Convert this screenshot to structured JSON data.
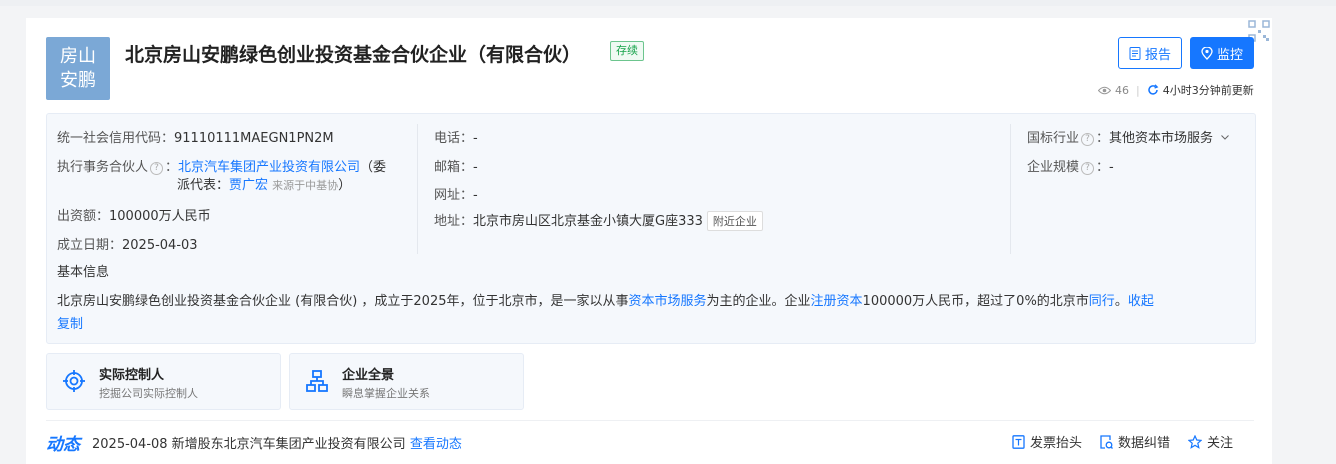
{
  "logo": {
    "line1": "房山",
    "line2": "安鹏"
  },
  "company": {
    "name": "北京房山安鹏绿色创业投资基金合伙企业（有限合伙）",
    "status": "存续"
  },
  "header": {
    "report_label": "报告",
    "monitor_label": "监控",
    "views": "46",
    "updated": "4小时3分钟前更新"
  },
  "info": {
    "credit_code_label": "统一社会信用代码：",
    "credit_code": "91110111MAEGN1PN2M",
    "partner_label": "执行事务合伙人",
    "partner_colon": "：",
    "partner_name": "北京汽车集团产业投资有限公司",
    "partner_suffix1": "（委",
    "partner_suffix2_a": "派代表：",
    "partner_rep": "贾广宏",
    "partner_source": "来源于中基协",
    "partner_close": "）",
    "capital_label": "出资额：",
    "capital": "100000万人民币",
    "founded_label": "成立日期：",
    "founded": "2025-04-03",
    "phone_label": "电话：",
    "phone": "-",
    "email_label": "邮箱：",
    "email": "-",
    "website_label": "网址：",
    "website": "-",
    "address_label": "地址：",
    "address": "北京市房山区北京基金小镇大厦G座333",
    "nearby_label": "附近企业",
    "industry_label": "国标行业",
    "industry": "其他资本市场服务",
    "scale_label": "企业规模",
    "scale": "-",
    "basic_title": "基本信息",
    "desc_part1": "北京房山安鹏绿色创业投资基金合伙企业 (有限合伙) ，成立于2025年，位于北京市，是一家以从事",
    "desc_link1": "资本市场服务",
    "desc_part2": "为主的企业。企业",
    "desc_link2": "注册资本",
    "desc_part3": "100000万人民币，超过了0%的北京市",
    "desc_link3": "同行",
    "desc_part4": "。",
    "collapse": "收起",
    "copy": "复制"
  },
  "tiles": [
    {
      "title": "实际控制人",
      "subtitle": "挖掘公司实际控制人"
    },
    {
      "title": "企业全景",
      "subtitle": "瞬息掌握企业关系"
    }
  ],
  "dynamics": {
    "label": "动态",
    "text": "2025-04-08 新增股东北京汽车集团产业投资有限公司",
    "link": "查看动态"
  },
  "actions": {
    "invoice": "发票抬头",
    "correction": "数据纠错",
    "follow": "关注"
  },
  "colors": {
    "accent": "#1677ff",
    "status_green": "#16a34a",
    "logo_bg": "#7ba8d6"
  }
}
